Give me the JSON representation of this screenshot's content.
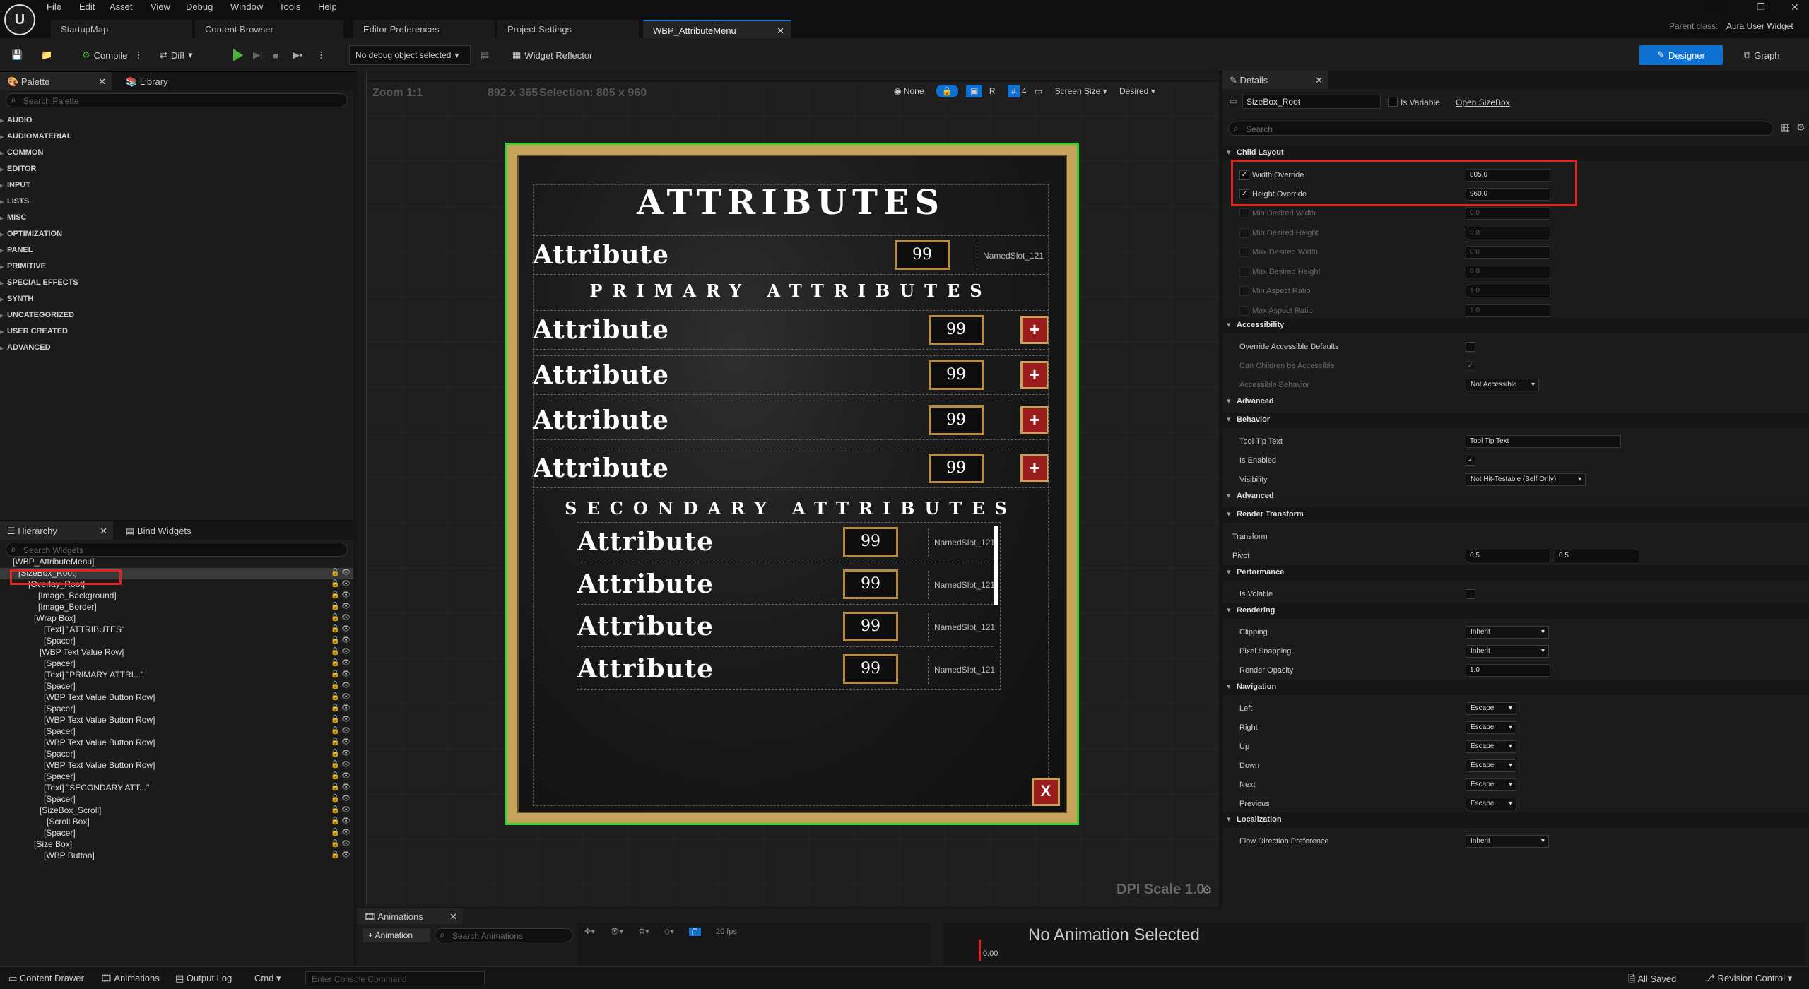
{
  "menu": [
    "File",
    "Edit",
    "Asset",
    "View",
    "Debug",
    "Window",
    "Tools",
    "Help"
  ],
  "doc_tabs": [
    "StartupMap",
    "Content Browser",
    "Editor Preferences",
    "Project Settings",
    "WBP_AttributeMenu"
  ],
  "parent_class_label": "Parent class:",
  "parent_class": "Aura User Widget",
  "toolbar": {
    "compile": "Compile",
    "diff": "Diff",
    "debug_select": "No debug object selected",
    "widget_reflector": "Widget Reflector",
    "designer": "Designer",
    "graph": "Graph"
  },
  "palette": {
    "tab": "Palette",
    "library_tab": "Library",
    "search_placeholder": "Search Palette",
    "categories": [
      "AUDIO",
      "AUDIOMATERIAL",
      "COMMON",
      "EDITOR",
      "INPUT",
      "LISTS",
      "MISC",
      "OPTIMIZATION",
      "PANEL",
      "PRIMITIVE",
      "SPECIAL EFFECTS",
      "SYNTH",
      "UNCATEGORIZED",
      "USER CREATED",
      "ADVANCED"
    ]
  },
  "hierarchy": {
    "tab": "Hierarchy",
    "bind_tab": "Bind Widgets",
    "search_placeholder": "Search Widgets",
    "rows": [
      "[WBP_AttributeMenu]",
      "[SizeBox_Root]",
      "[Overlay_Root]",
      "[Image_Background]",
      "[Image_Border]",
      "[Wrap Box]",
      "[Text] \"ATTRIBUTES\"",
      "[Spacer]",
      "[WBP Text Value Row]",
      "[Spacer]",
      "[Text] \"PRIMARY ATTRI...\"",
      "[Spacer]",
      "[WBP Text Value Button Row]",
      "[Spacer]",
      "[WBP Text Value Button Row]",
      "[Spacer]",
      "[WBP Text Value Button Row]",
      "[Spacer]",
      "[WBP Text Value Button Row]",
      "[Spacer]",
      "[Text] \"SECONDARY ATT...\"",
      "[Spacer]",
      "[SizeBox_Scroll]",
      "[Scroll Box]",
      "[Spacer]",
      "[Size Box]",
      "[WBP Button]"
    ]
  },
  "viewport": {
    "zoom": "Zoom 1:1",
    "size": "892 x 365",
    "selection": "Selection: 805 x 960",
    "none": "None",
    "r": "R",
    "grid": "4",
    "screen_size": "Screen Size",
    "desired": "Desired",
    "dpi": "DPI Scale 1.0"
  },
  "widget": {
    "title": "ATTRIBUTES",
    "primary": "PRIMARY ATTRIBUTES",
    "secondary": "SECONDARY ATTRIBUTES",
    "attr": "Attribute",
    "value": "99",
    "slot": "NamedSlot_121",
    "plus": "+",
    "close": "X"
  },
  "details": {
    "tab": "Details",
    "name": "SizeBox_Root",
    "is_variable": "Is Variable",
    "open": "Open SizeBox",
    "search_placeholder": "Search",
    "child_layout": "Child Layout",
    "width_override": "Width Override",
    "width_val": "805.0",
    "height_override": "Height Override",
    "height_val": "960.0",
    "min_w": "Min Desired Width",
    "min_h": "Min Desired Height",
    "max_w": "Max Desired Width",
    "max_h": "Max Desired Height",
    "min_ar": "Min Aspect Ratio",
    "max_ar": "Max Aspect Ratio",
    "zero": "0.0",
    "one": "1.0",
    "accessibility": "Accessibility",
    "override_acc": "Override Accessible Defaults",
    "children_acc": "Can Children be Accessible",
    "acc_behavior": "Accessible Behavior",
    "not_accessible": "Not Accessible",
    "advanced": "Advanced",
    "behavior": "Behavior",
    "tooltip": "Tool Tip Text",
    "enabled": "Is Enabled",
    "visibility": "Visibility",
    "vis_val": "Not Hit-Testable (Self Only)",
    "render_transform": "Render Transform",
    "transform": "Transform",
    "pivot": "Pivot",
    "pivot_x": "0.5",
    "pivot_y": "0.5",
    "performance": "Performance",
    "volatile": "Is Volatile",
    "rendering": "Rendering",
    "clipping": "Clipping",
    "inherit": "Inherit",
    "pixel_snap": "Pixel Snapping",
    "opacity": "Render Opacity",
    "navigation": "Navigation",
    "left": "Left",
    "right": "Right",
    "up": "Up",
    "down": "Down",
    "next": "Next",
    "previous": "Previous",
    "escape": "Escape",
    "localization": "Localization",
    "flow": "Flow Direction Preference"
  },
  "anim": {
    "tab": "Animations",
    "add": "+ Animation",
    "search_placeholder": "Search Animations",
    "fps": "20 fps",
    "none_selected": "No Animation Selected",
    "time": "0.00"
  },
  "status": {
    "drawer": "Content Drawer",
    "animations": "Animations",
    "output": "Output Log",
    "cmd": "Cmd",
    "console_placeholder": "Enter Console Command",
    "saved": "All Saved",
    "revision": "Revision Control"
  }
}
